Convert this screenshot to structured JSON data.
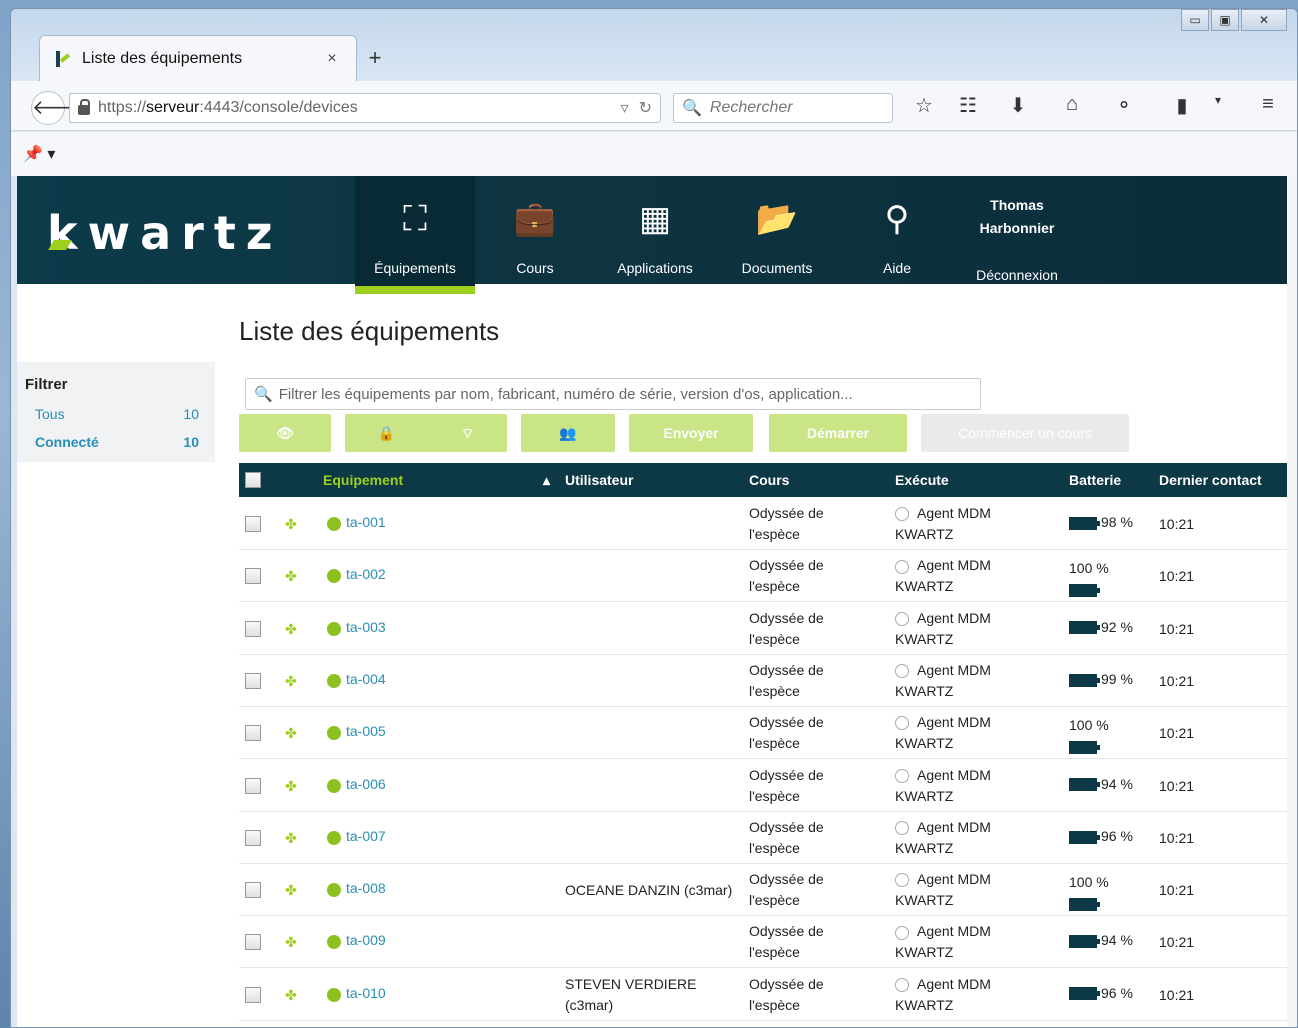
{
  "browser": {
    "tab_title": "Liste des équipements",
    "tab_close": "×",
    "new_tab": "+",
    "url_prefix": "https://",
    "url_host": "serveur",
    "url_rest": ":4443/console/devices",
    "search_placeholder": "Rechercher",
    "window_buttons": [
      "▭",
      "▣",
      "✕"
    ]
  },
  "header": {
    "brand": "kwartz",
    "nav": [
      {
        "label": "Équipements",
        "icon": "sitemap-icon",
        "active": true
      },
      {
        "label": "Cours",
        "icon": "briefcase-icon"
      },
      {
        "label": "Applications",
        "icon": "grid-icon"
      },
      {
        "label": "Documents",
        "icon": "folder-open-icon"
      },
      {
        "label": "Aide",
        "icon": "search-icon"
      }
    ],
    "user_first": "Thomas",
    "user_last": "Harbonnier",
    "logout": "Déconnexion"
  },
  "page": {
    "title": "Liste des équipements",
    "filter_placeholder": "Filtrer les équipements par nom, fabricant, numéro de série, version d'os, application...",
    "buttons": {
      "send": "Envoyer",
      "start": "Démarrer",
      "begin_course": "Commencer un cours"
    }
  },
  "sidebar": {
    "title": "Filtrer",
    "items": [
      {
        "label": "Tous",
        "count": "10"
      },
      {
        "label": "Connecté",
        "count": "10"
      }
    ]
  },
  "table": {
    "headers": [
      "Equipement",
      "Utilisateur",
      "Cours",
      "Exécute",
      "Batterie",
      "Dernier contact"
    ],
    "rows": [
      {
        "device": "ta-001",
        "user": "",
        "course1": "Odyssée de",
        "course2": "l'espèce",
        "app1": "Agent MDM",
        "app2": "KWARTZ",
        "battery": "98 %",
        "time": "10:21"
      },
      {
        "device": "ta-002",
        "user": "",
        "course1": "Odyssée de",
        "course2": "l'espèce",
        "app1": "Agent MDM",
        "app2": "KWARTZ",
        "battery": "100 %",
        "time": "10:21"
      },
      {
        "device": "ta-003",
        "user": "",
        "course1": "Odyssée de",
        "course2": "l'espèce",
        "app1": "Agent MDM",
        "app2": "KWARTZ",
        "battery": "92 %",
        "time": "10:21"
      },
      {
        "device": "ta-004",
        "user": "",
        "course1": "Odyssée de",
        "course2": "l'espèce",
        "app1": "Agent MDM",
        "app2": "KWARTZ",
        "battery": "99 %",
        "time": "10:21"
      },
      {
        "device": "ta-005",
        "user": "",
        "course1": "Odyssée de",
        "course2": "l'espèce",
        "app1": "Agent MDM",
        "app2": "KWARTZ",
        "battery": "100 %",
        "time": "10:21"
      },
      {
        "device": "ta-006",
        "user": "",
        "course1": "Odyssée de",
        "course2": "l'espèce",
        "app1": "Agent MDM",
        "app2": "KWARTZ",
        "battery": "94 %",
        "time": "10:21"
      },
      {
        "device": "ta-007",
        "user": "",
        "course1": "Odyssée de",
        "course2": "l'espèce",
        "app1": "Agent MDM",
        "app2": "KWARTZ",
        "battery": "96 %",
        "time": "10:21"
      },
      {
        "device": "ta-008",
        "user": "OCEANE DANZIN (c3mar)",
        "course1": "Odyssée de",
        "course2": "l'espèce",
        "app1": "Agent MDM",
        "app2": "KWARTZ",
        "battery": "100 %",
        "time": "10:21"
      },
      {
        "device": "ta-009",
        "user": "",
        "course1": "Odyssée de",
        "course2": "l'espèce",
        "app1": "Agent MDM",
        "app2": "KWARTZ",
        "battery": "94 %",
        "time": "10:21"
      },
      {
        "device": "ta-010",
        "user": "STEVEN VERDIERE (c3mar)",
        "course1": "Odyssée de",
        "course2": "l'espèce",
        "app1": "Agent MDM",
        "app2": "KWARTZ",
        "battery": "96 %",
        "time": "10:21"
      }
    ]
  },
  "colors": {
    "header_bg": "#0d3846",
    "accent": "#9ccf1e",
    "link": "#2a8fb6"
  }
}
